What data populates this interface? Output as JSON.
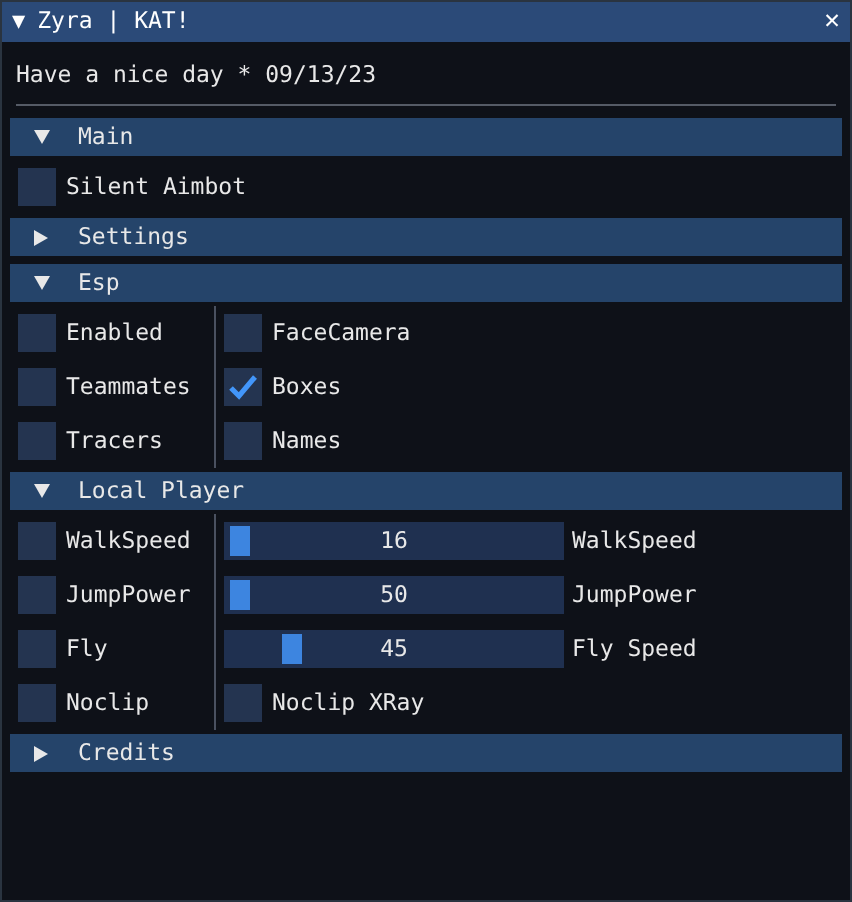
{
  "window": {
    "title": "Zyra | KAT!",
    "collapse_glyph": "▼",
    "close_glyph": "✕"
  },
  "greeting": "Have a nice day * 09/13/23",
  "sections": [
    {
      "title": "Main",
      "expanded": true,
      "rows": [
        {
          "left": {
            "kind": "checkbox",
            "label": "Silent Aimbot",
            "checked": false
          }
        }
      ]
    },
    {
      "title": "Settings",
      "expanded": false
    },
    {
      "title": "Esp",
      "expanded": true,
      "rows": [
        {
          "left": {
            "kind": "checkbox",
            "label": "Enabled",
            "checked": false
          },
          "right": {
            "kind": "checkbox",
            "label": "FaceCamera",
            "checked": false
          }
        },
        {
          "left": {
            "kind": "checkbox",
            "label": "Teammates",
            "checked": false
          },
          "right": {
            "kind": "checkbox",
            "label": "Boxes",
            "checked": true
          }
        },
        {
          "left": {
            "kind": "checkbox",
            "label": "Tracers",
            "checked": false
          },
          "right": {
            "kind": "checkbox",
            "label": "Names",
            "checked": false
          }
        }
      ]
    },
    {
      "title": "Local Player",
      "expanded": true,
      "rows": [
        {
          "left": {
            "kind": "checkbox",
            "label": "WalkSpeed",
            "checked": false
          },
          "right": {
            "kind": "slider",
            "value": "16",
            "level": 0,
            "label": "WalkSpeed"
          }
        },
        {
          "left": {
            "kind": "checkbox",
            "label": "JumpPower",
            "checked": false
          },
          "right": {
            "kind": "slider",
            "value": "50",
            "level": 0,
            "label": "JumpPower"
          }
        },
        {
          "left": {
            "kind": "checkbox",
            "label": "Fly",
            "checked": false
          },
          "right": {
            "kind": "slider",
            "value": "45",
            "level": 0.17,
            "label": "Fly Speed"
          }
        },
        {
          "left": {
            "kind": "checkbox",
            "label": "Noclip",
            "checked": false
          },
          "right": {
            "kind": "checkbox",
            "label": "Noclip XRay",
            "checked": false
          }
        }
      ]
    },
    {
      "title": "Credits",
      "expanded": false
    }
  ]
}
